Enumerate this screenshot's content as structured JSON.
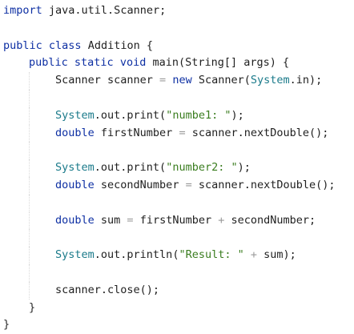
{
  "code": {
    "line1": {
      "kw": "import",
      "rest": " java.util.Scanner;"
    },
    "line3": {
      "kw1": "public",
      "kw2": "class",
      "name": " Addition {"
    },
    "line4": {
      "kw1": "public",
      "kw2": "static",
      "kw3": "void",
      "rest": " main(String[] args) {"
    },
    "line5": {
      "pre": "Scanner scanner ",
      "op": "=",
      "kw": "new",
      "a": " Scanner(",
      "sys": "System",
      "b": ".in);"
    },
    "line7": {
      "sys": "System",
      "a": ".out.print(",
      "str": "\"numbe1: \"",
      "b": ");"
    },
    "line8": {
      "kw": "double",
      "a": " firstNumber ",
      "op": "=",
      "b": " scanner.nextDouble();"
    },
    "line10": {
      "sys": "System",
      "a": ".out.print(",
      "str": "\"number2: \"",
      "b": ");"
    },
    "line11": {
      "kw": "double",
      "a": " secondNumber ",
      "op": "=",
      "b": " scanner.nextDouble();"
    },
    "line13": {
      "kw": "double",
      "a": " sum ",
      "op1": "=",
      "b": " firstNumber ",
      "op2": "+",
      "c": " secondNumber;"
    },
    "line15": {
      "sys": "System",
      "a": ".out.println(",
      "str": "\"Result: \"",
      "op": "+",
      "b": " sum);"
    },
    "line17": {
      "a": "scanner.close();"
    },
    "line18": {
      "a": "}"
    },
    "line19": {
      "a": "}"
    }
  },
  "colors": {
    "keyword": "#0d2fa3",
    "string": "#3a7d1f",
    "system": "#1a7a8a",
    "operator": "#9a9a9a",
    "background": "#ffffff"
  }
}
